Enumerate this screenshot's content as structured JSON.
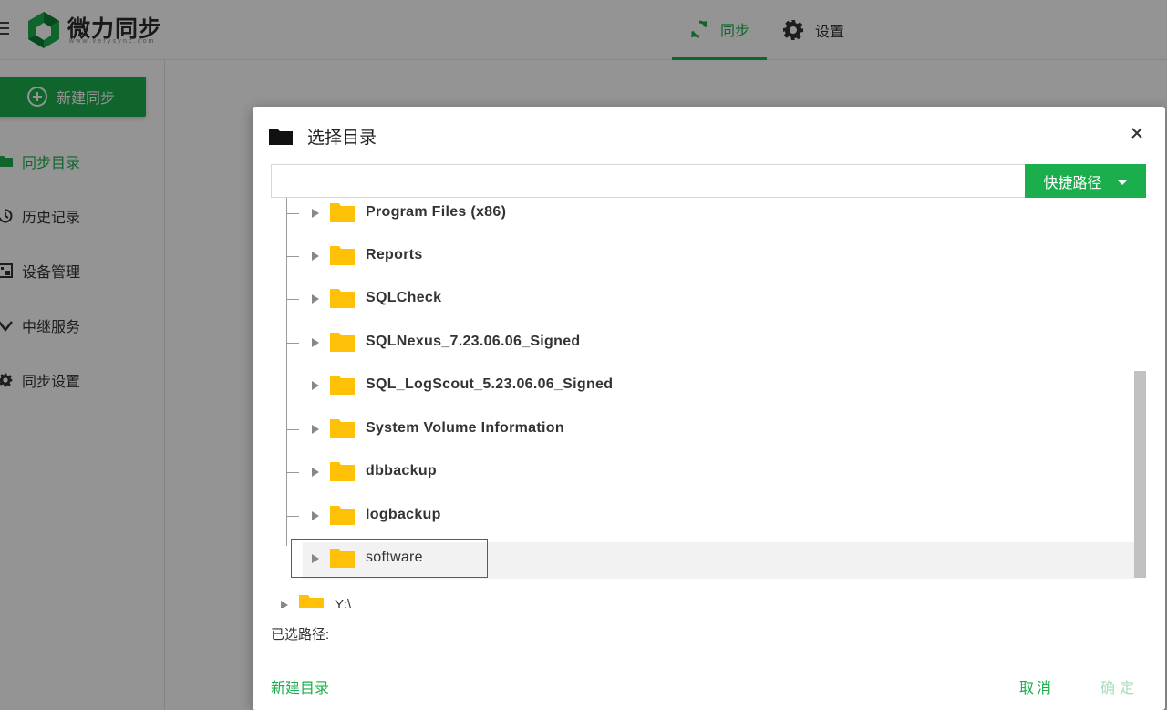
{
  "app": {
    "logo_text": "微力同步",
    "logo_subtext": "www.verysync.com"
  },
  "nav": {
    "tabs": [
      {
        "label": "同步",
        "icon": "sync-icon",
        "active": true
      },
      {
        "label": "设置",
        "icon": "gear-icon",
        "active": false
      }
    ]
  },
  "sidebar": {
    "new_sync_label": "新建同步",
    "items": [
      {
        "label": "同步目录",
        "icon": "folder-icon",
        "active": true
      },
      {
        "label": "历史记录",
        "icon": "history-icon",
        "active": false
      },
      {
        "label": "设备管理",
        "icon": "devices-icon",
        "active": false
      },
      {
        "label": "中继服务",
        "icon": "relay-icon",
        "active": false
      },
      {
        "label": "同步设置",
        "icon": "gear-icon",
        "active": false
      }
    ]
  },
  "dialog": {
    "title": "选择目录",
    "path_input_value": "",
    "quick_path_label": "快捷路径",
    "tree_items": [
      {
        "name": "Program Files (x86)"
      },
      {
        "name": "Reports"
      },
      {
        "name": "SQLCheck"
      },
      {
        "name": "SQLNexus_7.23.06.06_Signed"
      },
      {
        "name": "SQL_LogScout_5.23.06.06_Signed"
      },
      {
        "name": "System Volume Information"
      },
      {
        "name": "dbbackup"
      },
      {
        "name": "logbackup"
      },
      {
        "name": "software",
        "highlighted": true
      }
    ],
    "drive_label": "Y:\\",
    "selected_path_label": "已选路径:",
    "new_dir_label": "新建目录",
    "cancel_label": "取消",
    "confirm_label": "确定"
  },
  "colors": {
    "accent": "#1aae4c",
    "folder": "#ffc107",
    "highlight_border": "#d9242b"
  }
}
